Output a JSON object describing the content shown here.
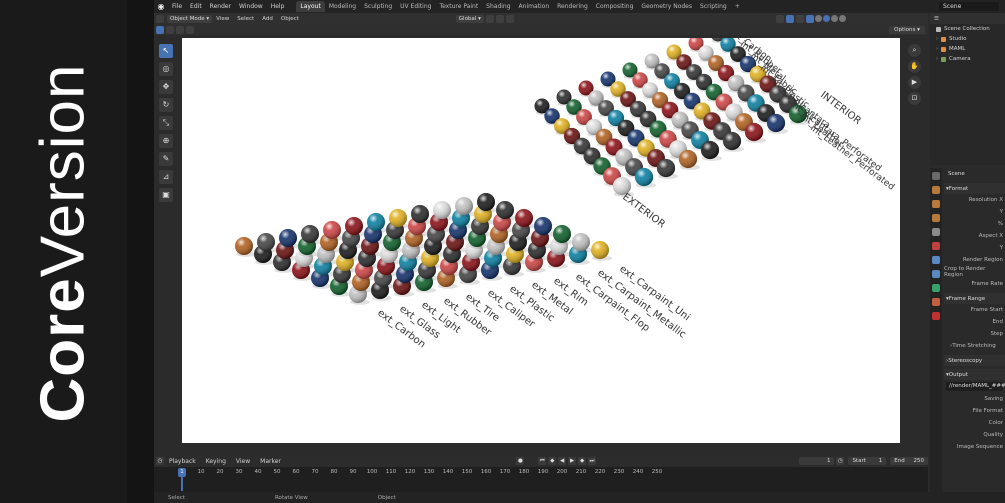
{
  "brand": {
    "bold": "Core",
    "light": "Version"
  },
  "topbar": {
    "menus": [
      "File",
      "Edit",
      "Render",
      "Window",
      "Help"
    ],
    "tabs": [
      "Layout",
      "Modeling",
      "Sculpting",
      "UV Editing",
      "Texture Paint",
      "Shading",
      "Animation",
      "Rendering",
      "Compositing",
      "Geometry Nodes",
      "Scripting",
      "+"
    ],
    "active_tab": "Layout",
    "scene": "Scene"
  },
  "viewport_header": {
    "mode": "Object Mode",
    "menus": [
      "View",
      "Select",
      "Add",
      "Object"
    ],
    "orientation": "Global",
    "options": "Options"
  },
  "toolbar": {
    "tools": [
      "select-icon",
      "cursor-icon",
      "move-icon",
      "rotate-icon",
      "scale-icon",
      "transform-icon",
      "annotate-icon",
      "measure-icon",
      "add-cube-icon"
    ]
  },
  "nav": {
    "buttons": [
      "zoom-icon",
      "pan-icon",
      "camera-icon",
      "lock-icon"
    ]
  },
  "scene_labels": {
    "interior_group": "INTERIOR",
    "interior": [
      "int_Carbon",
      "int_Rubber",
      "int_Metal",
      "int_Fabric",
      "int_Plastic",
      "int_Alcantara",
      "int_Alcantara_Perforated",
      "int_Leather",
      "int_Leather_Perforated"
    ],
    "exterior_group": "EXTERIOR",
    "exterior": [
      "ext_Carpaint_Uni",
      "ext_Carpaint_Metallic",
      "ext_Carpaint_Flop",
      "ext_Rim",
      "ext_Metal",
      "ext_Plastic",
      "ext_Caliper",
      "ext_Tire",
      "ext_Rubber",
      "ext_Light",
      "ext_Glass",
      "ext_Carbon"
    ]
  },
  "timeline": {
    "menus": [
      "Playback",
      "Keying",
      "View",
      "Marker"
    ],
    "current_frame": "1",
    "start_label": "Start",
    "start": "1",
    "end_label": "End",
    "end": "250",
    "ticks": [
      "1",
      "10",
      "20",
      "30",
      "40",
      "50",
      "60",
      "70",
      "80",
      "90",
      "100",
      "110",
      "120",
      "130",
      "140",
      "150",
      "160",
      "170",
      "180",
      "190",
      "200",
      "210",
      "220",
      "230",
      "240",
      "250"
    ]
  },
  "statusbar": [
    "Select",
    "Rotate View",
    "Object"
  ],
  "outliner": {
    "title": "Scene Collection",
    "items": [
      "Studio",
      "MAML",
      "Camera"
    ]
  },
  "properties": {
    "context": "Scene",
    "format_section": "Format",
    "format_rows": [
      "Resolution X",
      "Y",
      "%",
      "Aspect X",
      "Y",
      "Render Region",
      "Crop to Render Region",
      "Frame Rate"
    ],
    "frame_range_section": "Frame Range",
    "frame_rows": [
      "Frame Start",
      "End",
      "Step"
    ],
    "time_stretching": "Time Stretching",
    "stereoscopy": "Stereoscopy",
    "output_section": "Output",
    "output_path": "//render/MAML_###",
    "output_rows": [
      "Saving",
      "File Format",
      "Color",
      "Quality",
      "Image Sequence"
    ]
  }
}
